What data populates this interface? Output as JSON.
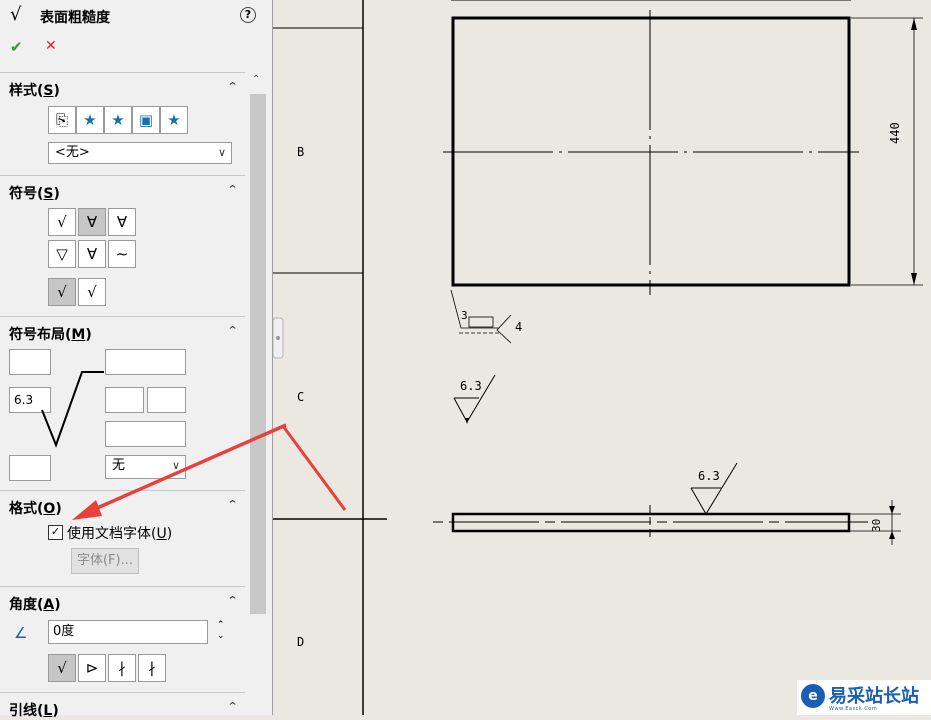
{
  "panel": {
    "title": "表面粗糙度",
    "title_icon": "√",
    "help": "?",
    "ok": "✔",
    "cancel": "✕",
    "sections": {
      "style": {
        "label": "样式(",
        "key": "S",
        "tail": ")",
        "combo_value": "<无>"
      },
      "symbol": {
        "label": "符号(",
        "key": "S",
        "tail": ")"
      },
      "layout": {
        "label": "符号布局(",
        "key": "M",
        "tail": ")",
        "value_a": "6.3",
        "combo_value": "无"
      },
      "format": {
        "label": "格式(",
        "key": "O",
        "tail": ")",
        "checkbox_label": "使用文档字体(",
        "checkbox_key": "U",
        "checkbox_tail": ")",
        "checked": true,
        "font_button": "字体(F)..."
      },
      "angle": {
        "label": "角度(",
        "key": "A",
        "tail": ")",
        "value": "0度"
      },
      "leader": {
        "label": "引线(",
        "key": "L",
        "tail": ")"
      }
    }
  },
  "drawing": {
    "zone_b": "B",
    "zone_c": "C",
    "zone_d": "D",
    "dim_height": "440",
    "dim_thickness": "30",
    "roughness_value_1": "6.3",
    "roughness_value_2": "6.3",
    "weld_left": "3",
    "weld_right": "4"
  },
  "watermark": {
    "text": "易采站长站",
    "sub": "Www.Easck.Com"
  },
  "colors": {
    "arrow": "#e8413c",
    "accent": "#1a5fb4"
  }
}
